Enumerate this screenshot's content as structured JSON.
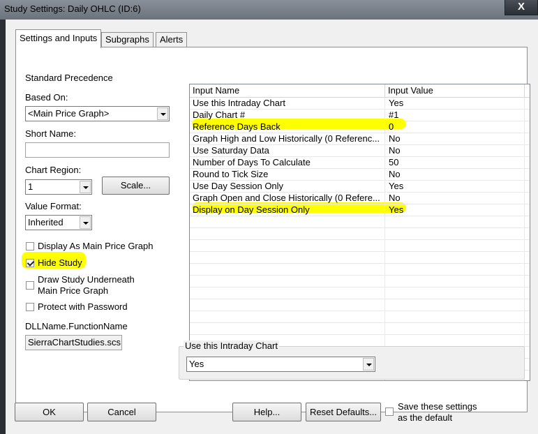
{
  "window": {
    "title": "Study Settings: Daily OHLC (ID:6)",
    "close_glyph": "X"
  },
  "tabs": [
    {
      "label": "Settings and Inputs"
    },
    {
      "label": "Subgraphs"
    },
    {
      "label": "Alerts"
    }
  ],
  "left": {
    "precedence": "Standard Precedence",
    "based_on_label": "Based On:",
    "based_on_value": "<Main Price Graph>",
    "short_name_label": "Short Name:",
    "short_name_value": "",
    "chart_region_label": "Chart Region:",
    "chart_region_value": "1",
    "scale_button": "Scale...",
    "value_format_label": "Value Format:",
    "value_format_value": "Inherited",
    "display_main_label": "Display As Main Price Graph",
    "hide_study_label": "Hide Study",
    "draw_underneath_line1": "Draw Study Underneath",
    "draw_underneath_line2": "Main Price Graph",
    "protect_label": "Protect with Password",
    "dll_label": "DLLName.FunctionName",
    "dll_value": "SierraChartStudies.scs"
  },
  "grid": {
    "columns": [
      "Input Name",
      "Input Value"
    ],
    "rows": [
      {
        "name": "Use this Intraday Chart",
        "value": "Yes"
      },
      {
        "name": "Daily Chart #",
        "value": "#1"
      },
      {
        "name": "Reference Days Back",
        "value": "0"
      },
      {
        "name": "Graph High and Low Historically (0 Referenc...",
        "value": "No"
      },
      {
        "name": "Use Saturday Data",
        "value": "No"
      },
      {
        "name": "Number of Days To Calculate",
        "value": "50"
      },
      {
        "name": "Round to Tick Size",
        "value": "No"
      },
      {
        "name": "Use Day Session Only",
        "value": "Yes"
      },
      {
        "name": "Graph Open and Close Historically (0 Refere...",
        "value": "No"
      },
      {
        "name": "Display on Day Session Only",
        "value": "Yes"
      }
    ]
  },
  "input_editor": {
    "label": "Use this Intraday Chart",
    "value": "Yes"
  },
  "buttons": {
    "ok": "OK",
    "cancel": "Cancel",
    "help": "Help...",
    "reset": "Reset Defaults...",
    "save_line1": "Save these settings",
    "save_line2": "as the default"
  },
  "colors": {
    "highlight": "#ffff00"
  }
}
